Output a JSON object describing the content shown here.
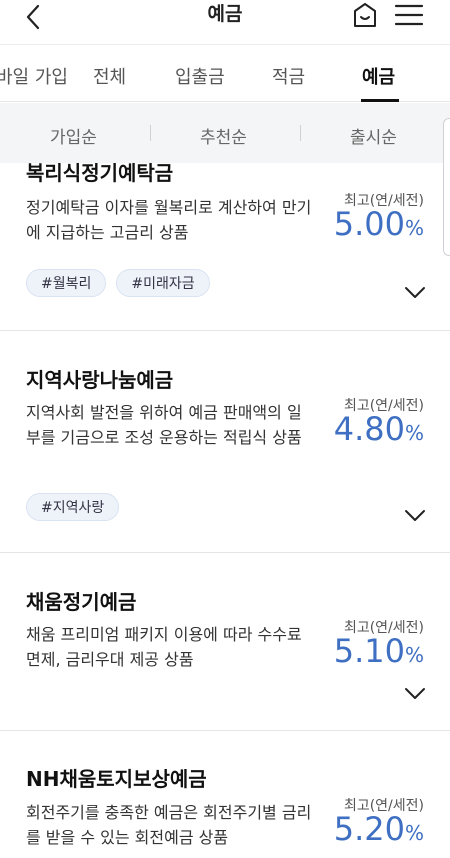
{
  "header": {
    "title": "예금"
  },
  "tabs": [
    {
      "label": "바일 가입"
    },
    {
      "label": "전체"
    },
    {
      "label": "입출금"
    },
    {
      "label": "적금"
    },
    {
      "label": "예금"
    }
  ],
  "sort": [
    {
      "label": "가입순"
    },
    {
      "label": "추천순"
    },
    {
      "label": "출시순"
    }
  ],
  "colors": {
    "accent": "#3e6fc2",
    "tag_bg": "#eef3fa"
  },
  "products": [
    {
      "name": "복리식정기예탁금",
      "desc": "정기예탁금 이자를 월복리로 계산하여 만기에 지급하는 고금리 상품",
      "rate_label": "최고(연/세전)",
      "rate": "5.00",
      "unit": "%",
      "tags": [
        "#월복리",
        "#미래자금"
      ]
    },
    {
      "name": "지역사랑나눔예금",
      "desc": "지역사회 발전을 위하여 예금 판매액의 일부를 기금으로 조성 운용하는 적립식 상품",
      "rate_label": "최고(연/세전)",
      "rate": "4.80",
      "unit": "%",
      "tags": [
        "#지역사랑"
      ]
    },
    {
      "name": "채움정기예금",
      "desc": "채움 프리미엄 패키지 이용에 따라 수수료 면제, 금리우대 제공 상품",
      "rate_label": "최고(연/세전)",
      "rate": "5.10",
      "unit": "%",
      "tags": []
    },
    {
      "name": "NH채움토지보상예금",
      "desc": "회전주기를 충족한 예금은 회전주기별 금리를 받을 수 있는 회전예금 상품",
      "rate_label": "최고(연/세전)",
      "rate": "5.20",
      "unit": "%",
      "tags": []
    }
  ]
}
